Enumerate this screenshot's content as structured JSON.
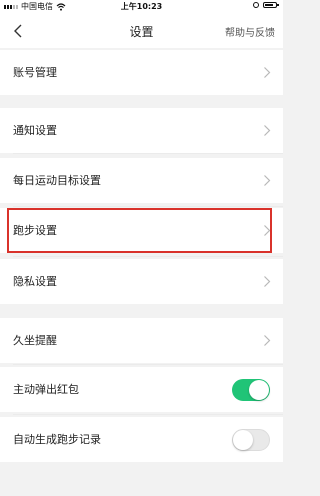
{
  "status_bar": {
    "carrier": "中国电信",
    "time": "上午10:23",
    "icons": [
      "signal-icon",
      "wifi-icon",
      "alarm-icon",
      "battery-icon"
    ]
  },
  "nav": {
    "title": "设置",
    "help": "帮助与反馈",
    "back_icon": "chevron-left-icon"
  },
  "settings": {
    "account": "账号管理",
    "notifications": "通知设置",
    "daily_goal": "每日运动目标设置",
    "running": "跑步设置",
    "privacy": "隐私设置",
    "sedentary": "久坐提醒",
    "auto_red_packet": "主动弹出红包",
    "auto_run_record": "自动生成跑步记录"
  },
  "toggles": {
    "auto_red_packet_on": true,
    "auto_run_record_on": false
  },
  "colors": {
    "toggle_on": "#20c477",
    "highlight": "#d9322b",
    "background": "#f2f2f2"
  }
}
